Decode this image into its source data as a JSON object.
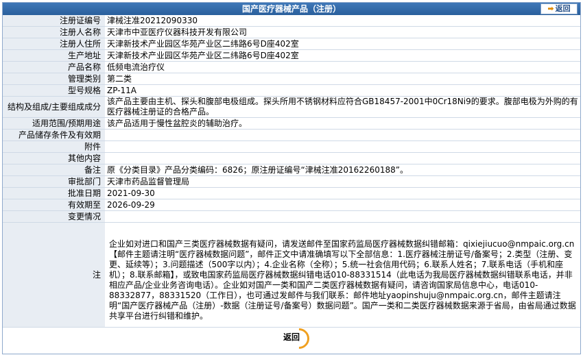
{
  "page": {
    "title": "国产医疗器械产品（注册）",
    "back_top_label": "返回",
    "back_bottom_label": "返回"
  },
  "rows": [
    {
      "label": "注册证编号",
      "value": "津械注准20212090330"
    },
    {
      "label": "注册人名称",
      "value": "天津市中亚医疗仪器科技开发有限公司"
    },
    {
      "label": "注册人住所",
      "value": "天津新技术产业园区华苑产业区二纬路6号D座402室"
    },
    {
      "label": "生产地址",
      "value": "天津新技术产业园区华苑产业区二纬路6号D座402室"
    },
    {
      "label": "产品名称",
      "value": "低频电流治疗仪"
    },
    {
      "label": "管理类别",
      "value": "第二类"
    },
    {
      "label": "型号规格",
      "value": "ZP-11A"
    },
    {
      "label": "结构及组成/主要组成成分",
      "value": "该产品主要由主机、探头和腹部电极组成。探头所用不锈钢材料应符合GB18457-2001中0Cr18Ni9的要求。腹部电极为外购的有医疗器械注册证的合格产品。"
    },
    {
      "label": "适用范围/预期用途",
      "value": "该产品适用于慢性盆腔炎的辅助治疗。"
    },
    {
      "label": "产品储存条件及有效期",
      "value": ""
    },
    {
      "label": "附件",
      "value": ""
    },
    {
      "label": "其他内容",
      "value": ""
    },
    {
      "label": "备注",
      "value": "原《分类目录》产品分类编码：6826；原注册证编号“津械注准20162260188”。"
    },
    {
      "label": "审批部门",
      "value": "天津市药品监督管理局"
    },
    {
      "label": "批准日期",
      "value": "2021-09-30"
    },
    {
      "label": "有效期至",
      "value": "2026-09-29"
    },
    {
      "label": "变更情况",
      "value": ""
    }
  ],
  "notes": {
    "label": "注",
    "text": "企业如对进口和国产三类医疗器械数据有疑问，请发送邮件至国家药监局医疗器械数据纠错邮箱：qixiejiucuo@nmpaic.org.cn【邮件主题请注明“医疗器械数据问题”，邮件正文中请准确填写以下全部信息：1.医疗器械注册证号/备案号；2.类型（注册、变更、延续等）；3.问题描述（500字以内）；4.企业名称（全称）；5.统一社会信用代码；6.联系人姓名；7.联系电话（手机和座机）；8.联系邮箱】，或致电国家药监局医疗器械数据纠错电话010-88331514（此电话为我局医疗器械数据纠错联系电话，并非相应产品/企业业务咨询电话）。企业如对国产一类和国产二类医疗器械数据有疑问，请咨询国家局信息中心，电话010-88332877，88331520（工作日），也可通过发邮件与我们联系：邮件地址yaopinshuju@nmpaic.org.cn，邮件主题请注明“国产医疗器械产品（注册）-数据（注册证号/备案号）数据问题”。国产一类和二类医疗器械数据来源于省局，由省局通过数据共享平台进行纠错和维护。"
  }
}
